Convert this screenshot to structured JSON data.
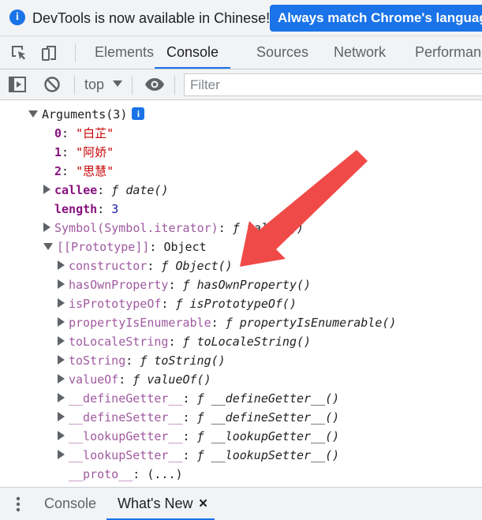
{
  "infobar": {
    "message": "DevTools is now available in Chinese!",
    "button_label": "Always match Chrome's language"
  },
  "tabs": [
    {
      "label": "Elements",
      "active": false
    },
    {
      "label": "Console",
      "active": true
    },
    {
      "label": "Sources",
      "active": false
    },
    {
      "label": "Network",
      "active": false
    },
    {
      "label": "Performance",
      "active": false
    }
  ],
  "console_toolbar": {
    "context": "top",
    "filter_placeholder": "Filter"
  },
  "console": {
    "arguments_label": "Arguments(3)",
    "items": [
      {
        "key": "0",
        "value": "\"白芷\""
      },
      {
        "key": "1",
        "value": "\"阿娇\""
      },
      {
        "key": "2",
        "value": "\"思慧\""
      }
    ],
    "callee": {
      "key": "callee",
      "value": "date()"
    },
    "length": {
      "key": "length",
      "value": "3"
    },
    "symbol": {
      "key": "Symbol(Symbol.iterator)",
      "value": "values()"
    },
    "prototype": {
      "key": "[[Prototype]]",
      "value": "Object"
    },
    "proto_members": [
      {
        "key": "constructor",
        "value": "Object()"
      },
      {
        "key": "hasOwnProperty",
        "value": "hasOwnProperty()"
      },
      {
        "key": "isPrototypeOf",
        "value": "isPrototypeOf()"
      },
      {
        "key": "propertyIsEnumerable",
        "value": "propertyIsEnumerable()"
      },
      {
        "key": "toLocaleString",
        "value": "toLocaleString()"
      },
      {
        "key": "toString",
        "value": "toString()"
      },
      {
        "key": "valueOf",
        "value": "valueOf()"
      },
      {
        "key": "__defineGetter__",
        "value": "__defineGetter__()"
      },
      {
        "key": "__defineSetter__",
        "value": "__defineSetter__()"
      },
      {
        "key": "__lookupGetter__",
        "value": "__lookupGetter__()"
      },
      {
        "key": "__lookupSetter__",
        "value": "__lookupSetter__()"
      }
    ],
    "proto_accessor": {
      "key": "__proto__",
      "value": "(...)"
    },
    "function_symbol": "ƒ"
  },
  "drawer": {
    "tabs": [
      {
        "label": "Console",
        "active": false
      },
      {
        "label": "What's New",
        "active": true
      }
    ],
    "close_symbol": "×"
  },
  "colors": {
    "accent": "#1a73e8",
    "annotation_arrow": "#f04a48",
    "key": "#881280",
    "string": "#c80000",
    "number": "#1a1aa6"
  },
  "icons": [
    "info-icon",
    "inspect-element-icon",
    "device-toolbar-icon",
    "sidebar-toggle-icon",
    "clear-console-icon",
    "dropdown-arrow-icon",
    "eye-icon",
    "kebab-menu-icon",
    "close-icon"
  ]
}
